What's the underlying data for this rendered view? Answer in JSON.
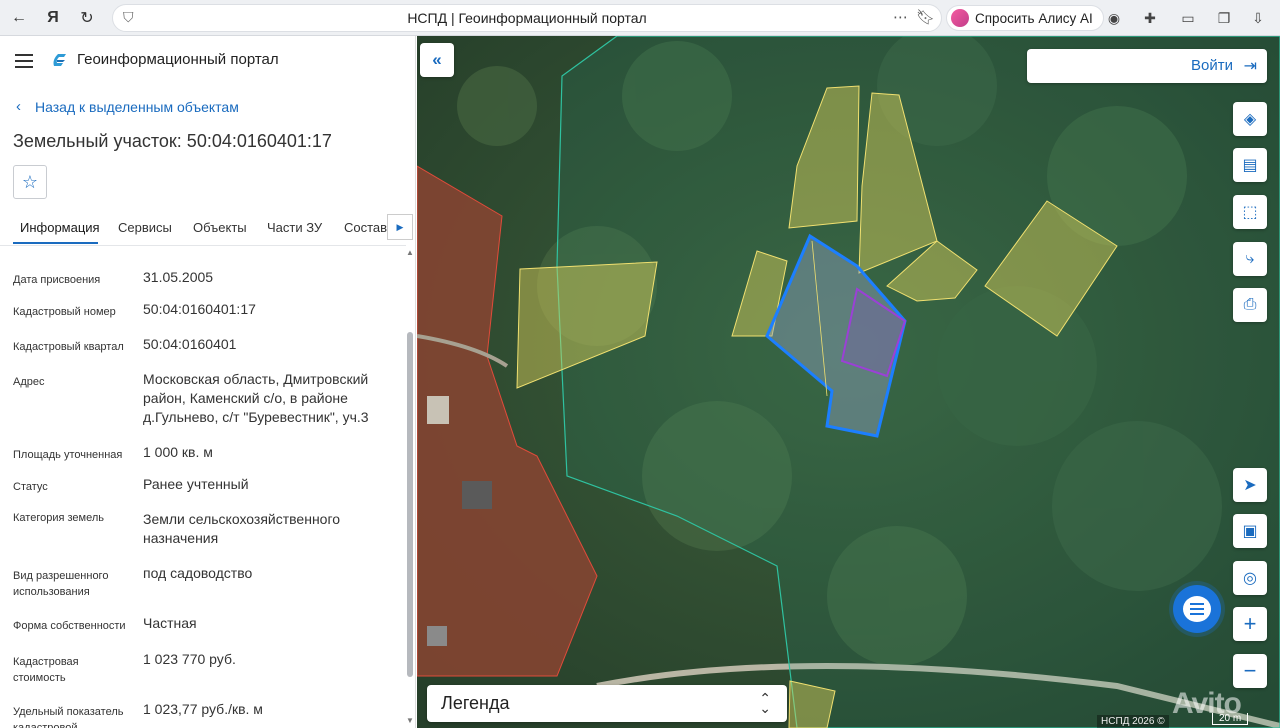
{
  "browser": {
    "tab_title": "НСПД | Геоинформационный портал",
    "alisa_label": "Спросить Алису AI"
  },
  "panel": {
    "portal_title": "Геоинформационный портал",
    "back_label": "Назад к выделенным объектам",
    "parcel_title": "Земельный участок: 50:04:0160401:17",
    "tabs": [
      "Информация",
      "Сервисы",
      "Объекты",
      "Части ЗУ",
      "Состав"
    ],
    "fields": [
      {
        "label": "Дата присвоения",
        "value": "31.05.2005"
      },
      {
        "label": "Кадастровый номер",
        "value": "50:04:0160401:17"
      },
      {
        "label": "Кадастровый квартал",
        "value": "50:04:0160401"
      },
      {
        "label": "Адрес",
        "value": "Московская область, Дмитровский район, Каменский с/о, в районе д.Гульнево, с/т \"Буревестник\", уч.3"
      },
      {
        "label": "Площадь уточненная",
        "value": "1 000 кв. м"
      },
      {
        "label": "Статус",
        "value": "Ранее учтенный"
      },
      {
        "label": "Категория земель",
        "value": "Земли сельскохозяйственного назначения"
      },
      {
        "label": "Вид разрешенного использования",
        "value": "под садоводство"
      },
      {
        "label": "Форма собственности",
        "value": "Частная"
      },
      {
        "label": "Кадастровая стоимость",
        "value": "1 023 770 руб."
      },
      {
        "label": "Удельный показатель кадастровой",
        "value": "1 023,77 руб./кв. м"
      }
    ]
  },
  "map": {
    "login_label": "Войти",
    "legend_label": "Легенда",
    "copyright": "НСПД 2026 ©",
    "scale_label": "20 m",
    "watermark": "Avito"
  }
}
